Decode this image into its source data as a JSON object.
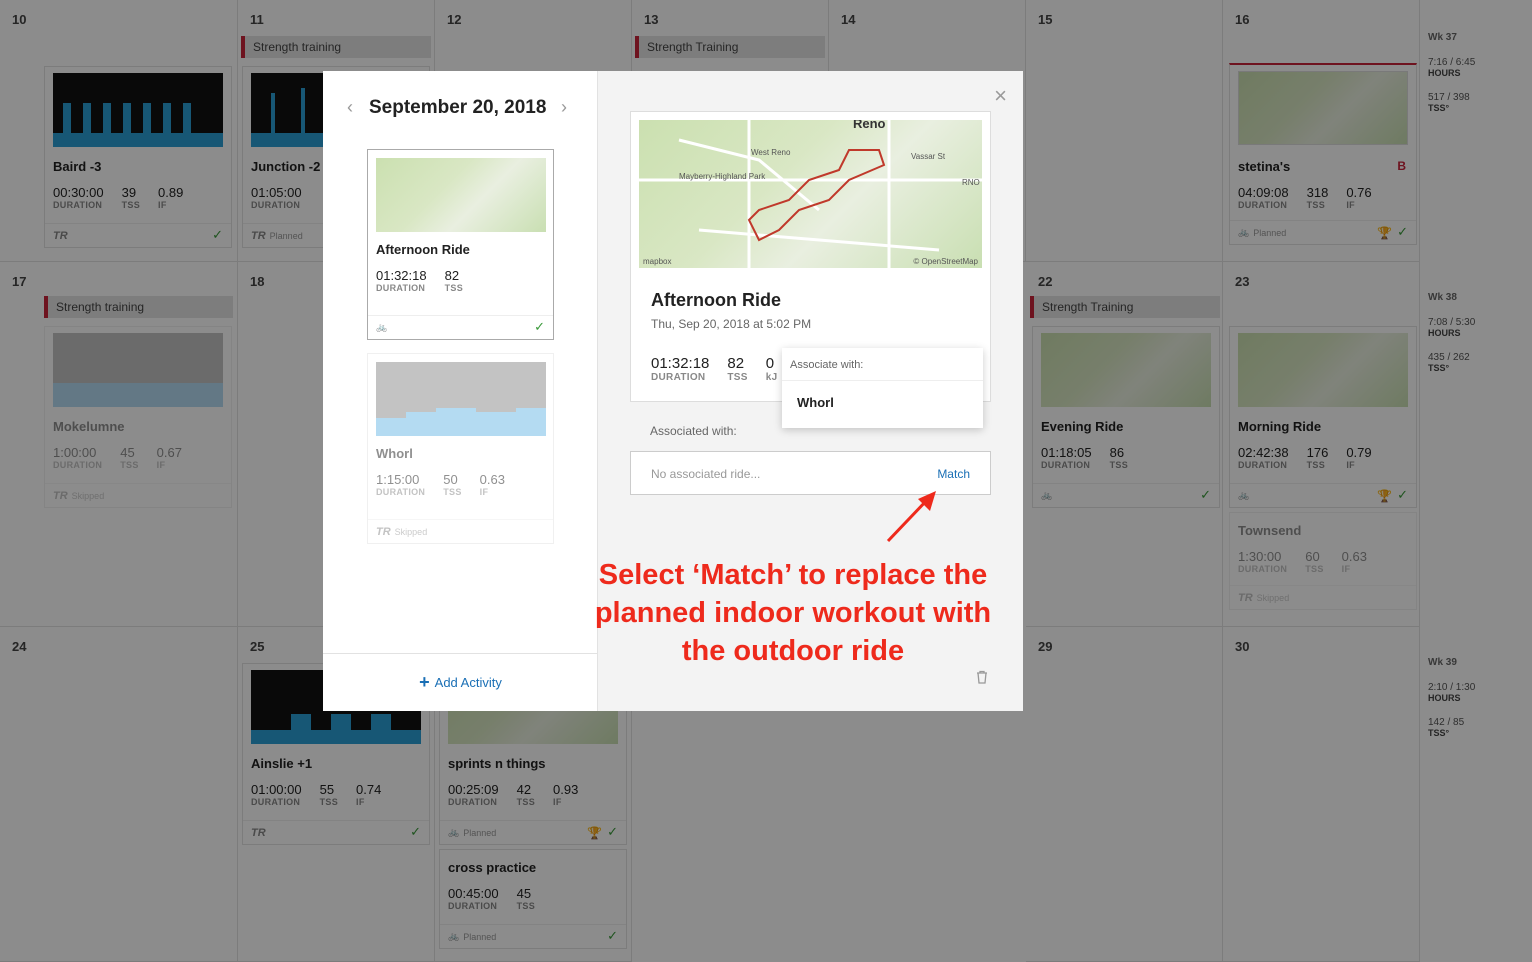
{
  "calendar": {
    "day_numbers": [
      "10",
      "11",
      "12",
      "13",
      "14",
      "15",
      "16",
      "17",
      "18",
      "22",
      "23",
      "24",
      "25",
      "29",
      "30"
    ],
    "strength_labels": [
      "Strength training",
      "Strength Training",
      "Strength training",
      "Strength Training"
    ],
    "cards": [
      {
        "title": "Baird -3",
        "duration": "00:30:00",
        "tss": "39",
        "if": "0.89",
        "footer": "TR"
      },
      {
        "title": "Junction -2",
        "duration": "01:05:00",
        "footer": "Planned"
      },
      {
        "title": "stetina's",
        "duration": "04:09:08",
        "tss": "318",
        "if": "0.76",
        "badge": "B",
        "footer": "Planned"
      },
      {
        "title": "Mokelumne",
        "duration": "1:00:00",
        "tss": "45",
        "if": "0.67",
        "footer": "Skipped"
      },
      {
        "title": "Evening Ride",
        "duration": "01:18:05",
        "tss": "86"
      },
      {
        "title": "Morning Ride",
        "duration": "02:42:38",
        "tss": "176",
        "if": "0.79"
      },
      {
        "title": "Townsend",
        "duration": "1:30:00",
        "tss": "60",
        "if": "0.63",
        "footer": "Skipped"
      },
      {
        "title": "Ainslie +1",
        "duration": "01:00:00",
        "tss": "55",
        "if": "0.74",
        "footer": "TR"
      },
      {
        "title": "sprints n things",
        "duration": "00:25:09",
        "tss": "42",
        "if": "0.93",
        "footer": "Planned"
      },
      {
        "title": "cross practice",
        "duration": "00:45:00",
        "tss": "45",
        "footer": "Planned"
      }
    ],
    "labels": {
      "duration": "DURATION",
      "tss": "TSS",
      "if": "IF",
      "tr": "TR"
    },
    "weeks": [
      {
        "wk": "Wk 37",
        "hours": "7:16 / 6:45",
        "hours_label": "HOURS",
        "tss": "517 / 398",
        "tss_label": "TSS°"
      },
      {
        "wk": "Wk 38",
        "hours": "7:08 / 5:30",
        "hours_label": "HOURS",
        "tss": "435 / 262",
        "tss_label": "TSS°"
      },
      {
        "wk": "Wk 39",
        "hours": "2:10 / 1:30",
        "hours_label": "HOURS",
        "tss": "142 / 85",
        "tss_label": "TSS°"
      }
    ]
  },
  "modal": {
    "date": "September 20, 2018",
    "cards": [
      {
        "title": "Afternoon Ride",
        "duration": "01:32:18",
        "tss": "82"
      },
      {
        "title": "Whorl",
        "duration": "1:15:00",
        "tss": "50",
        "if": "0.63",
        "footer": "Skipped"
      }
    ],
    "add_activity": "Add Activity",
    "detail": {
      "title": "Afternoon Ride",
      "date": "Thu, Sep 20, 2018 at 5:02 PM",
      "duration": "01:32:18",
      "tss": "82",
      "kj": "0",
      "kj_label": "kJ",
      "map_credit": "© OpenStreetMap",
      "map_brand": "mapbox",
      "map_city": "Reno",
      "map_places": [
        "West Reno",
        "Vassar St",
        "Mayberry-Highland Park",
        "RNO"
      ]
    },
    "popup": {
      "header": "Associate with:",
      "option": "Whorl"
    },
    "associated_label": "Associated with:",
    "assoc_placeholder": "No associated ride...",
    "match_label": "Match"
  },
  "annotation": [
    "Select ‘Match’ to replace the",
    "planned indoor workout with",
    "the outdoor ride"
  ],
  "colors": {
    "accent": "#1a6fb5",
    "annotation": "#ee2a1c",
    "strength_bar": "#c8233a",
    "check": "#3a9a3a"
  }
}
